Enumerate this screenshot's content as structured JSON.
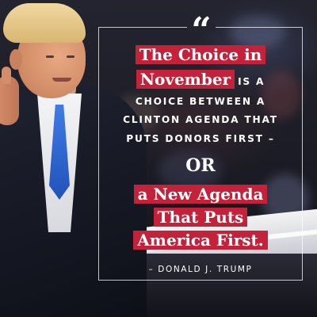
{
  "quote": {
    "mark": "“",
    "lines": [
      {
        "type": "highlight",
        "text": "The Choice in"
      },
      {
        "type": "mixed",
        "highlight": "November",
        "plain": "IS A"
      },
      {
        "type": "plain",
        "text": "CHOICE BETWEEN A"
      },
      {
        "type": "plain",
        "text": "CLINTON AGENDA THAT"
      },
      {
        "type": "plain",
        "text": "PUTS DONORS FIRST –"
      },
      {
        "type": "or",
        "text": "OR"
      },
      {
        "type": "highlight",
        "text": "a New Agenda"
      },
      {
        "type": "highlight",
        "text": "That Puts"
      },
      {
        "type": "highlight",
        "text": "America First."
      }
    ],
    "attribution": "– DONALD J. TRUMP"
  },
  "colors": {
    "highlight_bg": "#c4213a",
    "text": "#ffffff",
    "tie": "#3f7be6"
  }
}
